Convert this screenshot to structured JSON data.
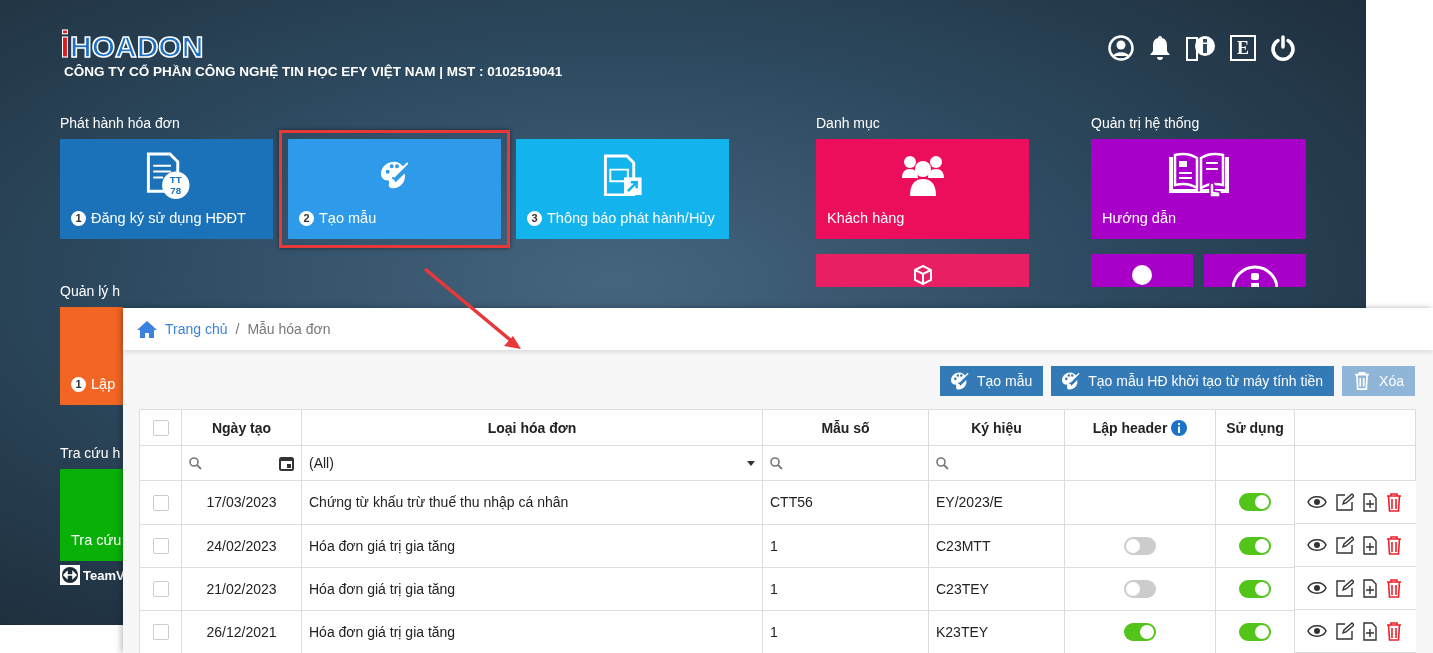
{
  "header": {
    "logo_mark": "i",
    "logo_text": "HOADON",
    "company": "CÔNG TY CỔ PHẦN CÔNG NGHỆ TIN HỌC EFY VIỆT NAM | MST : 0102519041",
    "tools": [
      {
        "kind": "user"
      },
      {
        "kind": "bell"
      },
      {
        "kind": "guide"
      },
      {
        "kind": "letter",
        "label": "E"
      },
      {
        "kind": "power"
      }
    ]
  },
  "issue": {
    "title": "Phát hành hóa đơn",
    "tiles": [
      {
        "number": "1",
        "label": "Đăng ký sử dụng HĐĐT",
        "icon_text": "TT 78",
        "color": "#1b72b8",
        "highlighted": false
      },
      {
        "number": "2",
        "label": "Tạo mẫu",
        "color": "#2d9bea",
        "highlighted": true
      },
      {
        "number": "3",
        "label": "Thông báo phát hành/Hủy",
        "color": "#13b3ee",
        "highlighted": false
      }
    ]
  },
  "manage": {
    "title": "Quản lý h",
    "tile": {
      "number": "1",
      "label": "Lập",
      "color": "#f26522"
    }
  },
  "lookup": {
    "title": "Tra cứu h",
    "tile": {
      "label": "Tra cứu",
      "color": "#08b008"
    },
    "remote_tool": "TeamV"
  },
  "catalog": {
    "title": "Danh mục",
    "tiles": [
      {
        "label": "Khách hàng",
        "color": "#ec0d5d"
      },
      {
        "color": "#e91f63"
      }
    ]
  },
  "admin": {
    "title": "Quản trị hệ thống",
    "tiles": [
      {
        "label": "Hướng dẫn",
        "color": "#a900c9"
      }
    ],
    "small_tiles": [
      {
        "color": "#a900c9"
      },
      {
        "color": "#a900c9"
      }
    ]
  },
  "panel": {
    "breadcrumb": {
      "separator": "/",
      "items": [
        {
          "label": "Trang chủ",
          "link": true
        },
        {
          "label": "Mẫu hóa đơn",
          "link": false
        }
      ]
    },
    "buttons": [
      {
        "label": "Tạo mẫu",
        "disabled": false
      },
      {
        "label": "Tạo mẫu HĐ khởi tạo từ máy tính tiền",
        "disabled": false
      },
      {
        "label": "Xóa",
        "disabled": true
      }
    ],
    "table": {
      "select_all": {
        "checked": false
      },
      "columns": [
        {
          "label": "Ngày tạo"
        },
        {
          "label": "Loại hóa đơn",
          "filter_value": "(All)"
        },
        {
          "label": "Mẫu số"
        },
        {
          "label": "Ký hiệu"
        },
        {
          "label": "Lập header",
          "info": true
        },
        {
          "label": "Sử dụng"
        }
      ],
      "rows": [
        {
          "checked": false,
          "date": "17/03/2023",
          "type": "Chứng từ khấu trừ thuế thu nhập cá nhân",
          "form": "CTT56",
          "symbol": "EY/2023/E",
          "in_use": true
        },
        {
          "checked": false,
          "date": "24/02/2023",
          "type": "Hóa đơn giá trị gia tăng",
          "form": "1",
          "symbol": "C23MTT",
          "repeat_header": false,
          "in_use": true
        },
        {
          "checked": false,
          "date": "21/02/2023",
          "type": "Hóa đơn giá trị gia tăng",
          "form": "1",
          "symbol": "C23TEY",
          "repeat_header": false,
          "in_use": true
        },
        {
          "checked": false,
          "date": "26/12/2021",
          "type": "Hóa đơn giá trị gia tăng",
          "form": "1",
          "symbol": "K23TEY",
          "repeat_header": true,
          "in_use": true
        }
      ]
    }
  }
}
